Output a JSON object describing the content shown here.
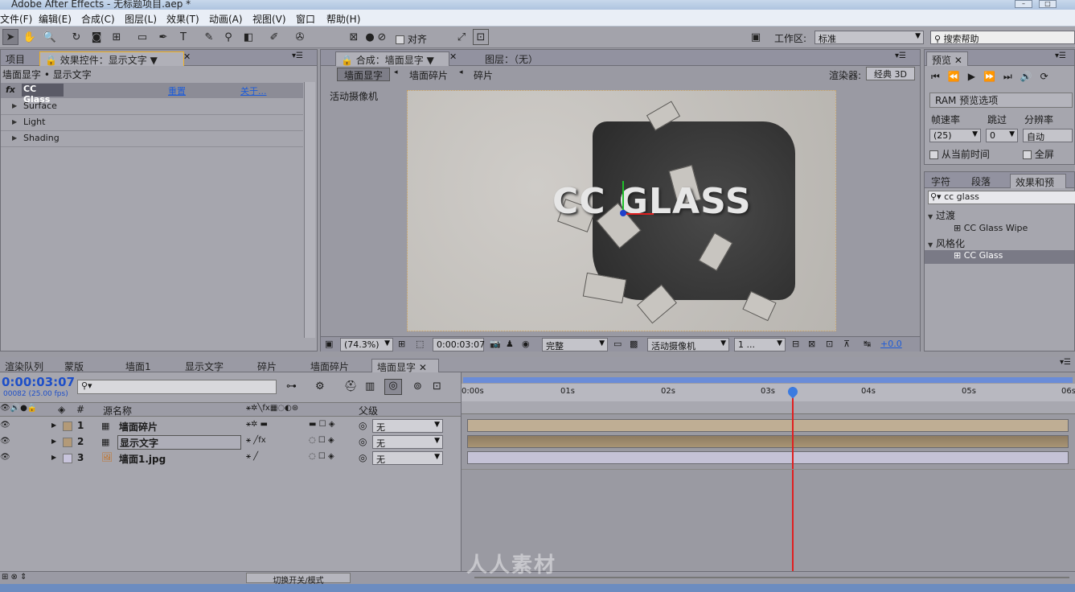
{
  "window": {
    "title": "Adobe After Effects - 无标题项目.aep *"
  },
  "menu": [
    "文件(F)",
    "编辑(E)",
    "合成(C)",
    "图层(L)",
    "效果(T)",
    "动画(A)",
    "视图(V)",
    "窗口",
    "帮助(H)"
  ],
  "toolbar": {
    "align_label": "对齐",
    "workspace_label": "工作区:",
    "workspace_value": "标准",
    "search_help": "搜索帮助"
  },
  "effects_panel": {
    "project_tab": "项目",
    "tab_label": "效果控件：显示文字",
    "breadcrumb": "墙面显字 • 显示文字",
    "effect_name": "CC Glass",
    "reset": "重置",
    "about": "关于...",
    "properties": [
      "Surface",
      "Light",
      "Shading"
    ]
  },
  "comp_panel": {
    "tab_label": "合成：墙面显字",
    "layer_tab": "图层：（无）",
    "nav": [
      "墙面显字",
      "墙面碎片",
      "碎片"
    ],
    "renderer_label": "渲染器:",
    "renderer_value": "经典 3D",
    "camera_label": "活动摄像机",
    "comp_text": "CC GLASS",
    "zoom": "(74.3%)",
    "timecode": "0:00:03:07",
    "quality": "完整",
    "view": "活动摄像机",
    "views_count": "1 ...",
    "exposure": "+0.0"
  },
  "preview_panel": {
    "tab": "预览",
    "ram_options": "RAM 预览选项",
    "framerate_label": "帧速率",
    "skip_label": "跳过",
    "resolution_label": "分辨率",
    "framerate_value": "(25)",
    "skip_value": "0",
    "resolution_value": "自动",
    "from_current": "从当前时间",
    "fullscreen": "全屏"
  },
  "effects_presets": {
    "tabs": [
      "字符",
      "段落",
      "效果和预"
    ],
    "search": "cc glass",
    "categories": [
      {
        "name": "过渡",
        "items": [
          "CC Glass Wipe"
        ]
      },
      {
        "name": "风格化",
        "items": [
          "CC Glass"
        ]
      }
    ]
  },
  "timeline": {
    "tabs": [
      "渲染队列",
      "蒙版",
      "墙面1",
      "显示文字",
      "碎片",
      "墙面碎片",
      "墙面显字"
    ],
    "timecode": "0:00:03:07",
    "frame_info": "00082 (25.00 fps)",
    "col_hash": "#",
    "col_source": "源名称",
    "col_parent": "父级",
    "layers": [
      {
        "num": "1",
        "name": "墙面碎片",
        "parent": "无",
        "color": "#b39a78"
      },
      {
        "num": "2",
        "name": "显示文字",
        "parent": "无",
        "color": "#b39a78"
      },
      {
        "num": "3",
        "name": "墙面1.jpg",
        "parent": "无",
        "color": "#c8c4dc"
      }
    ],
    "ruler": [
      "0:00s",
      "01s",
      "02s",
      "03s",
      "04s",
      "05s",
      "06s"
    ],
    "switch_mode": "切换开关/模式",
    "playhead_fraction": 0.5425
  },
  "watermark": "人人素材",
  "colors": {
    "accent_blue": "#1e5cd8",
    "playhead": "#e02020",
    "timecode": "#1e4fc8"
  }
}
